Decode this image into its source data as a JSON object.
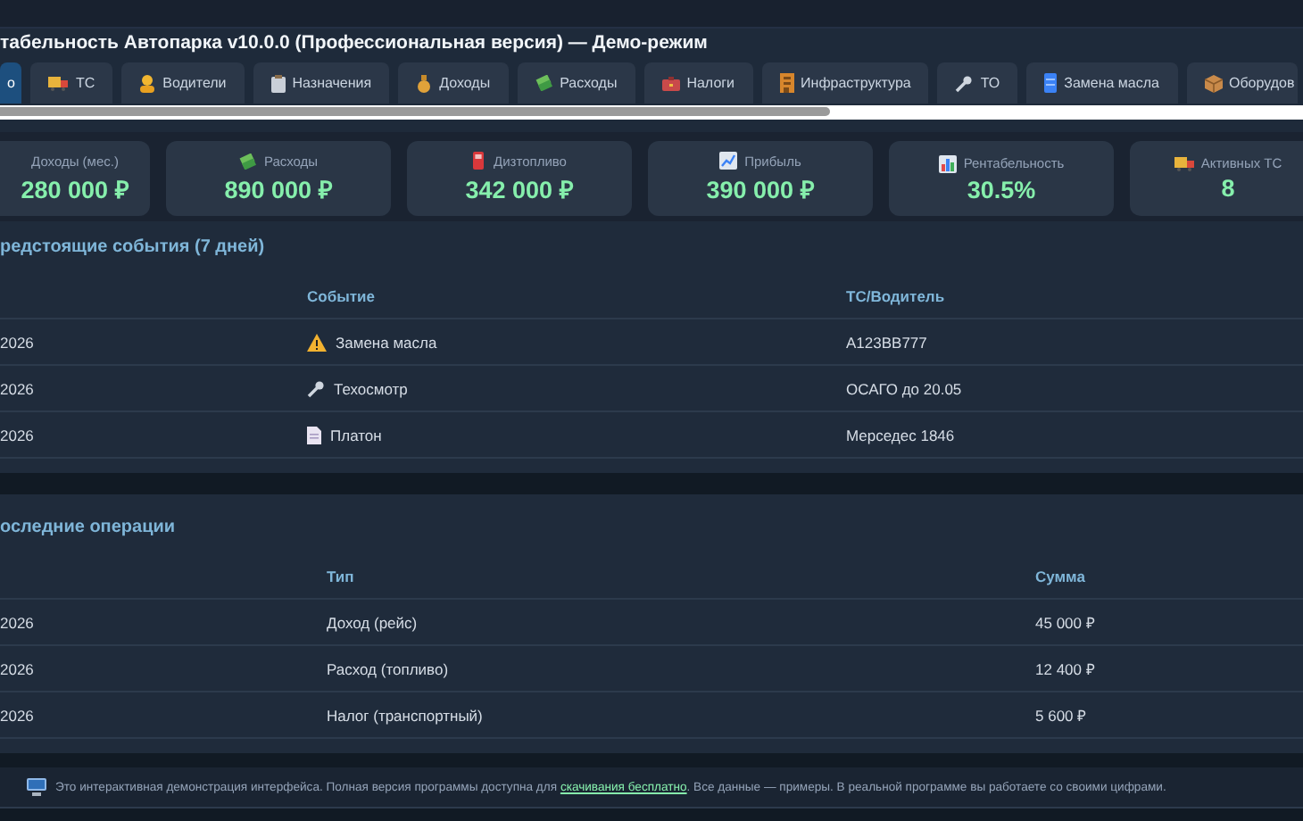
{
  "header": {
    "title": "табельность Автопарка v10.0.0 (Профессиональная версия) — Демо-режим"
  },
  "tabs": [
    {
      "label": "о",
      "selected": true
    },
    {
      "label": "ТС",
      "selected": false
    },
    {
      "label": "Водители",
      "selected": false
    },
    {
      "label": "Назначения",
      "selected": false
    },
    {
      "label": "Доходы",
      "selected": false
    },
    {
      "label": "Расходы",
      "selected": false
    },
    {
      "label": "Налоги",
      "selected": false
    },
    {
      "label": "Инфраструктура",
      "selected": false
    },
    {
      "label": "ТО",
      "selected": false
    },
    {
      "label": "Замена масла",
      "selected": false
    },
    {
      "label": "Оборудов",
      "selected": false
    }
  ],
  "stats": [
    {
      "label": "Доходы (мес.)",
      "value": "280 000 ₽"
    },
    {
      "label": "Расходы",
      "value": "890 000 ₽"
    },
    {
      "label": "Дизтопливо",
      "value": "342 000 ₽"
    },
    {
      "label": "Прибыль",
      "value": "390 000 ₽"
    },
    {
      "label": "Рентабельность",
      "value": "30.5%"
    },
    {
      "label": "Активных ТС",
      "value": "8"
    }
  ],
  "events": {
    "title": "редстоящие события (7 дней)",
    "columns": [
      "Событие",
      "ТС/Водитель"
    ],
    "rows": [
      {
        "date": "2026",
        "kind": "warning",
        "event": "Замена масла",
        "subject": "А123ВВ777"
      },
      {
        "date": "2026",
        "kind": "repair",
        "event": "Техосмотр",
        "subject": "ОСАГО до 20.05"
      },
      {
        "date": "2026",
        "kind": "document",
        "event": "Платон",
        "subject": "Мерседес 1846"
      }
    ]
  },
  "operations": {
    "title": "оследние операции",
    "columns": [
      "Тип",
      "Сумма"
    ],
    "rows": [
      {
        "date": "2026",
        "type": "Доход (рейс)",
        "amount": "45 000 ₽"
      },
      {
        "date": "2026",
        "type": "Расход (топливо)",
        "amount": "12 400 ₽"
      },
      {
        "date": "2026",
        "type": "Налог (транспортный)",
        "amount": "5 600 ₽"
      }
    ]
  },
  "footer": {
    "text_before": "Это интерактивная демонстрация интерфейса. Полная версия программы доступна для",
    "link": "скачивания бесплатно",
    "text_after": ". Все данные — примеры. В реальной программе вы работаете со своими цифрами."
  }
}
